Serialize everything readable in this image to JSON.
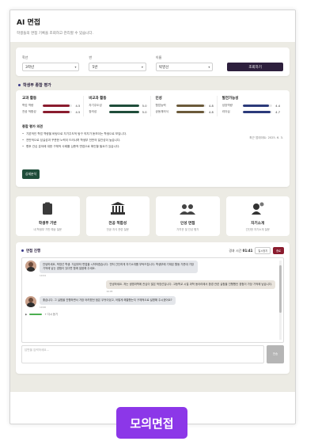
{
  "header": {
    "title": "AI 면접",
    "subtitle": "학생들의 면접 기록을 조회하고 관리할 수 있습니다."
  },
  "filters": [
    {
      "label": "학년",
      "value": "3학년"
    },
    {
      "label": "반",
      "value": "5반"
    },
    {
      "label": "이름",
      "value": "박영선"
    }
  ],
  "search_button": "조회하기",
  "evaluation": {
    "section_title": "학생부 종합 평가",
    "categories": [
      {
        "title": "교과 활동",
        "items": [
          {
            "label": "학업 역량",
            "value": "4.5",
            "level": 0.9,
            "color": "#8a1c2e"
          },
          {
            "label": "전공 적합성",
            "value": "4.5",
            "level": 0.9,
            "color": "#8a1c2e"
          }
        ]
      },
      {
        "title": "비교과 활동",
        "items": [
          {
            "label": "자기주도성",
            "value": "5.0",
            "level": 1.0,
            "color": "#1f4d3a"
          },
          {
            "label": "창의성",
            "value": "5.0",
            "level": 1.0,
            "color": "#1f4d3a"
          }
        ]
      },
      {
        "title": "인성",
        "items": [
          {
            "label": "협업능력",
            "value": "4.8",
            "level": 0.96,
            "color": "#6b5a3a"
          },
          {
            "label": "공동체의식",
            "value": "4.8",
            "level": 0.96,
            "color": "#6b5a3a"
          }
        ]
      },
      {
        "title": "발전가능성",
        "items": [
          {
            "label": "성장역량",
            "value": "4.4",
            "level": 0.88,
            "color": "#2b3a7a"
          },
          {
            "label": "리더십",
            "value": "4.7",
            "level": 0.94,
            "color": "#2b3a7a"
          }
        ]
      }
    ],
    "overall_title": "종합 평가 의견",
    "updated": "최근 업데이트: 2025. 6. 3.",
    "notes": [
      "기본적인 학업 역량을 바탕으로 자기주도적 탐구 의지가 돋보이는 학생으로 보입니다.",
      "전반적으로 성실성과 꾸준한 노력이 드러나며 학생부 전반의 일관성이 높습니다.",
      "향후 관심 분야에 대한 구체적 사례를 심층적 면접으로 확인할 필요가 있습니다."
    ],
    "detail_button": "상세분석"
  },
  "tiles": [
    {
      "icon": "clipboard-icon",
      "title": "학생부 기반",
      "subtitle": "내 학생부 기반 예상 질문"
    },
    {
      "icon": "bank-icon",
      "title": "전공 적합성",
      "subtitle": "전공 지식 관련 질문"
    },
    {
      "icon": "users-icon",
      "title": "인성 면접",
      "subtitle": "가치관 및 인성 평가"
    },
    {
      "icon": "person-speech-icon",
      "title": "자기소개",
      "subtitle": "간단한 자기소개 질문"
    }
  ],
  "interview": {
    "title": "면접 진행",
    "timer_label": "경과 시간",
    "timer_value": "01:41",
    "pause_label": "일시정지",
    "end_label": "종료",
    "messages": [
      {
        "role": "ai",
        "text": "안녕하세요, 박영선 학생. 지금부터 면접을 시작하겠습니다. 먼저 간단하게 자기소개를 부탁드립니다. 학생부에 기재된 활동 가운데 가장 기억에 남는 경험이 있다면 함께 말씀해 주세요.",
        "time": "10:04"
      },
      {
        "role": "user",
        "text": "안녕하세요. 저는 생명과학에 관심이 많은 박영선입니다. 고등학교 시절 과학 동아리에서 환경 관련 실험을 진행했던 경험이 가장 기억에 남습니다.",
        "time": "10:05"
      },
      {
        "role": "ai",
        "text": "좋습니다. 그 실험을 진행하면서 가장 어려웠던 점은 무엇이었고, 어떻게 해결했는지 구체적으로 설명해 주시겠어요?",
        "time": "10:06"
      }
    ],
    "audio_label": "+ 다시 듣기",
    "input_placeholder": "답변을 입력하세요...",
    "send_label": "전송"
  },
  "floating_label": "모의면접"
}
